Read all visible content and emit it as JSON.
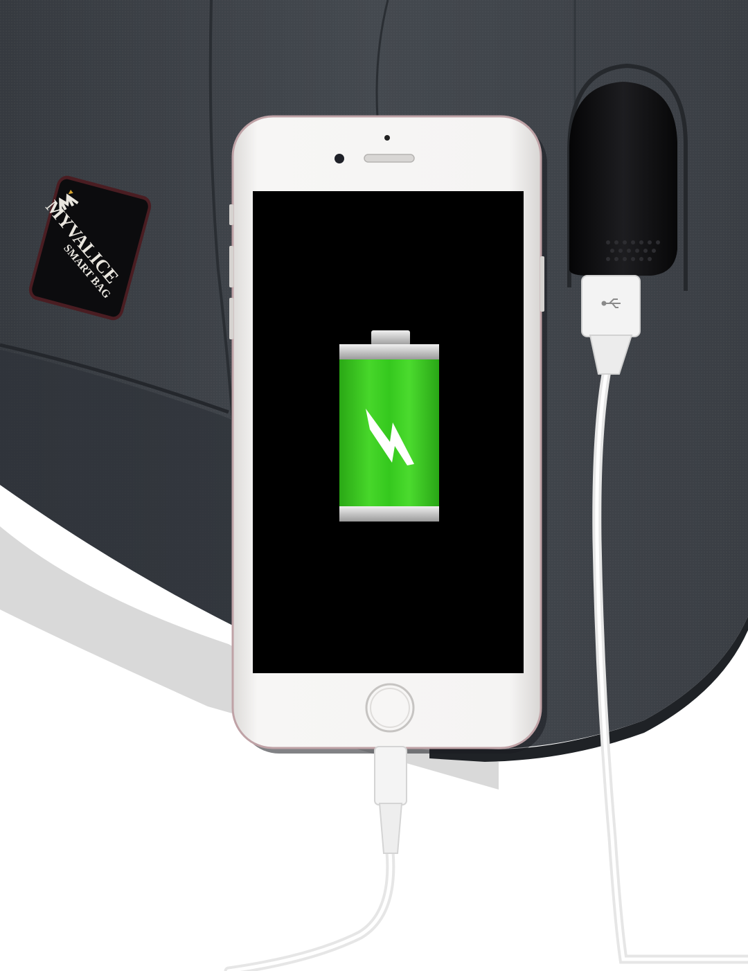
{
  "scene": {
    "description_colors": {
      "background": "#ffffff",
      "bag_fabric": "#3c4148",
      "bag_fabric_dark": "#2c3036",
      "phone_body": "#f4f3f2",
      "phone_screen": "#000000",
      "battery_green": "#35c81e",
      "battery_cap": "#c9c9c9",
      "usb_port": "#0e0e10",
      "cable": "#f2f2f2",
      "patch_text": "#e9e6df",
      "patch_accent": "#d5a431"
    }
  },
  "badge": {
    "brand_line1": "MYVALICE",
    "brand_line2": "SMART BAG"
  },
  "phone": {
    "charging_level_fraction": 1.0
  },
  "icons": {
    "battery": "battery-charging-icon",
    "bolt": "lightning-bolt-icon",
    "usb": "usb-symbol-icon",
    "logo": "myvalice-logo-icon"
  }
}
